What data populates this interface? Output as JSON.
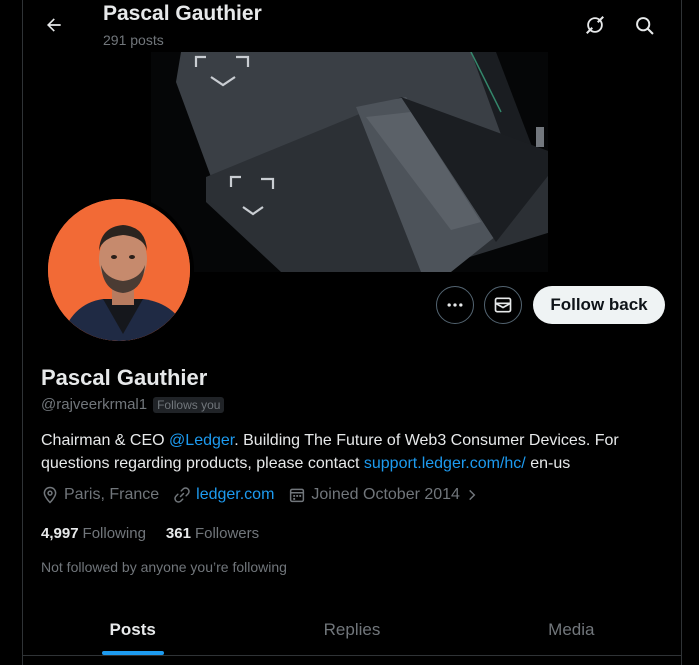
{
  "header": {
    "name": "Pascal Gauthier",
    "posts_count": "291 posts"
  },
  "profile": {
    "name": "Pascal Gauthier",
    "handle": "@rajveerkrmal1",
    "follows_you": "Follows you",
    "follow_button": "Follow back",
    "bio": {
      "part1": "Chairman & CEO ",
      "mention": "@Ledger",
      "part2": ". Building The Future of Web3 Consumer Devices. For questions regarding products, please contact ",
      "link": "support.ledger.com/hc/",
      "part3": " en-us"
    },
    "location": "Paris, France",
    "website": "ledger.com",
    "joined": "Joined October 2014",
    "following_count": "4,997",
    "following_label": "Following",
    "followers_count": "361",
    "followers_label": "Followers",
    "not_followed": "Not followed by anyone you’re following"
  },
  "tabs": [
    {
      "label": "Posts",
      "active": true
    },
    {
      "label": "Replies",
      "active": false
    },
    {
      "label": "Media",
      "active": false
    }
  ],
  "icons": {
    "back": "arrow-left-icon",
    "grok": "grok-icon",
    "search": "search-icon",
    "more": "more-icon",
    "message": "envelope-icon",
    "location": "location-pin-icon",
    "website": "link-icon",
    "joined": "calendar-icon",
    "chevron": "chevron-right-icon"
  },
  "colors": {
    "accent": "#1d9bf0",
    "background": "#000000",
    "muted": "#71767b",
    "avatar_bg": "#f26a36"
  }
}
